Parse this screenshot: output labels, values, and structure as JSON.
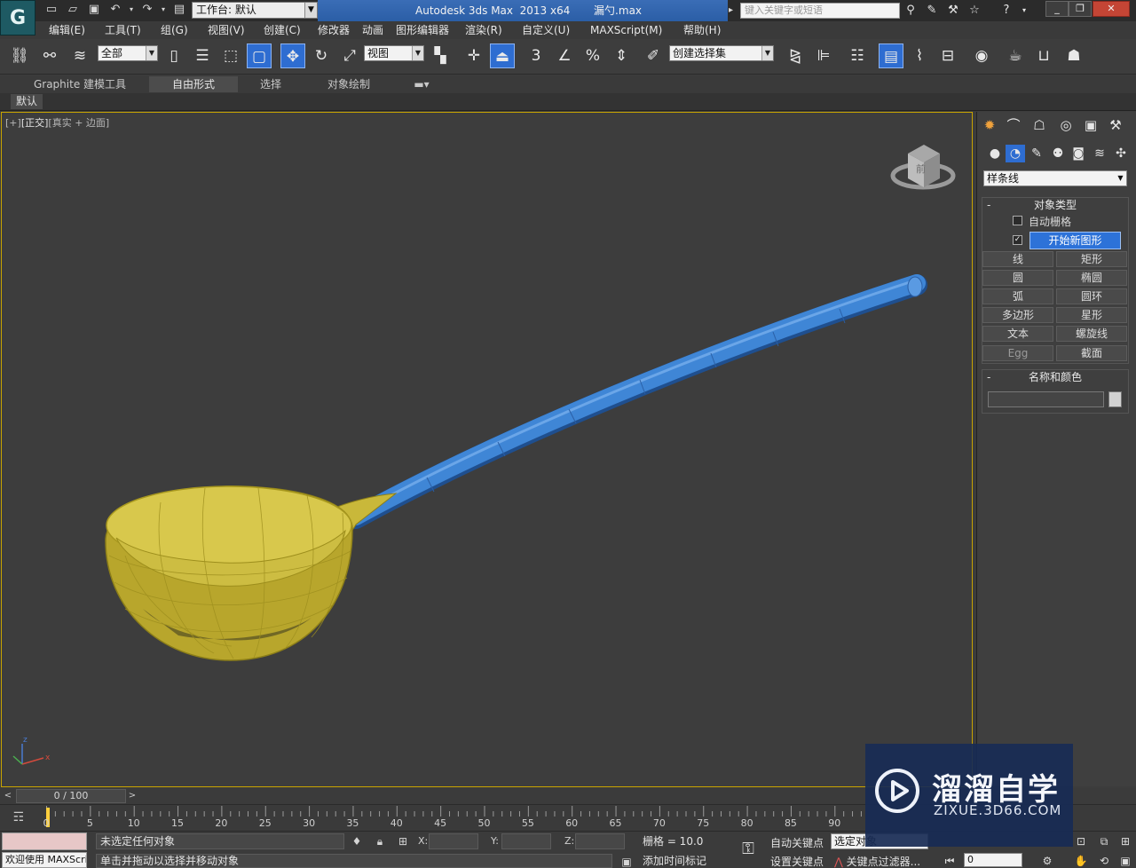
{
  "title_bar": {
    "app_logo": "G",
    "workspace_label": "工作台: 默认",
    "window_title": "Autodesk 3ds Max  2013 x64       漏勺.max",
    "search_placeholder": "键入关键字或短语"
  },
  "menu": [
    "编辑(E)",
    "工具(T)",
    "组(G)",
    "视图(V)",
    "创建(C)",
    "修改器",
    "动画",
    "图形编辑器",
    "渲染(R)",
    "自定义(U)",
    "MAXScript(M)",
    "帮助(H)"
  ],
  "toolbar": {
    "selection_filter": "全部",
    "reference_coord": "视图",
    "snap_percent": "3",
    "named_selection": "创建选择集"
  },
  "ribbon": {
    "tabs": [
      "Graphite 建模工具",
      "自由形式",
      "选择",
      "对象绘制"
    ],
    "default_label": "默认"
  },
  "viewport": {
    "label_plus": "[+]",
    "label_view": "[正交]",
    "label_shading": "[真实 + 边面]",
    "viewcube_face": "前"
  },
  "command_panel": {
    "category": "样条线",
    "object_type": {
      "title": "对象类型",
      "auto_grid": "自动栅格",
      "start_new_shape": "开始新图形",
      "buttons": [
        "线",
        "矩形",
        "圆",
        "椭圆",
        "弧",
        "圆环",
        "多边形",
        "星形",
        "文本",
        "螺旋线",
        "Egg",
        "截面"
      ]
    },
    "name_color": {
      "title": "名称和颜色"
    }
  },
  "timeline": {
    "slider": "0 / 100",
    "ticks": [
      "0",
      "5",
      "10",
      "15",
      "20",
      "25",
      "30",
      "35",
      "40",
      "45",
      "50",
      "55",
      "60",
      "65",
      "70",
      "75",
      "80",
      "85",
      "90"
    ],
    "current_frame": 0
  },
  "statusbar": {
    "maxscript": "欢迎使用 MAXScri",
    "selection_status": "未选定任何对象",
    "prompt": "单击并拖动以选择并移动对象",
    "x_label": "X:",
    "y_label": "Y:",
    "z_label": "Z:",
    "grid": "栅格 = 10.0",
    "add_time_tag": "添加时间标记",
    "auto_key": "自动关键点",
    "set_key": "设置关键点",
    "key_mode": "选定对象",
    "key_filters": "关键点过滤器...",
    "frame": "0"
  },
  "watermark": {
    "title": "溜溜自学",
    "url": "ZIXUE.3D66.COM"
  },
  "colors": {
    "bowl": "#c9b83a",
    "handle": "#3f86d6",
    "viewport_border": "#c8a400",
    "active_button": "#2e6dd1"
  }
}
